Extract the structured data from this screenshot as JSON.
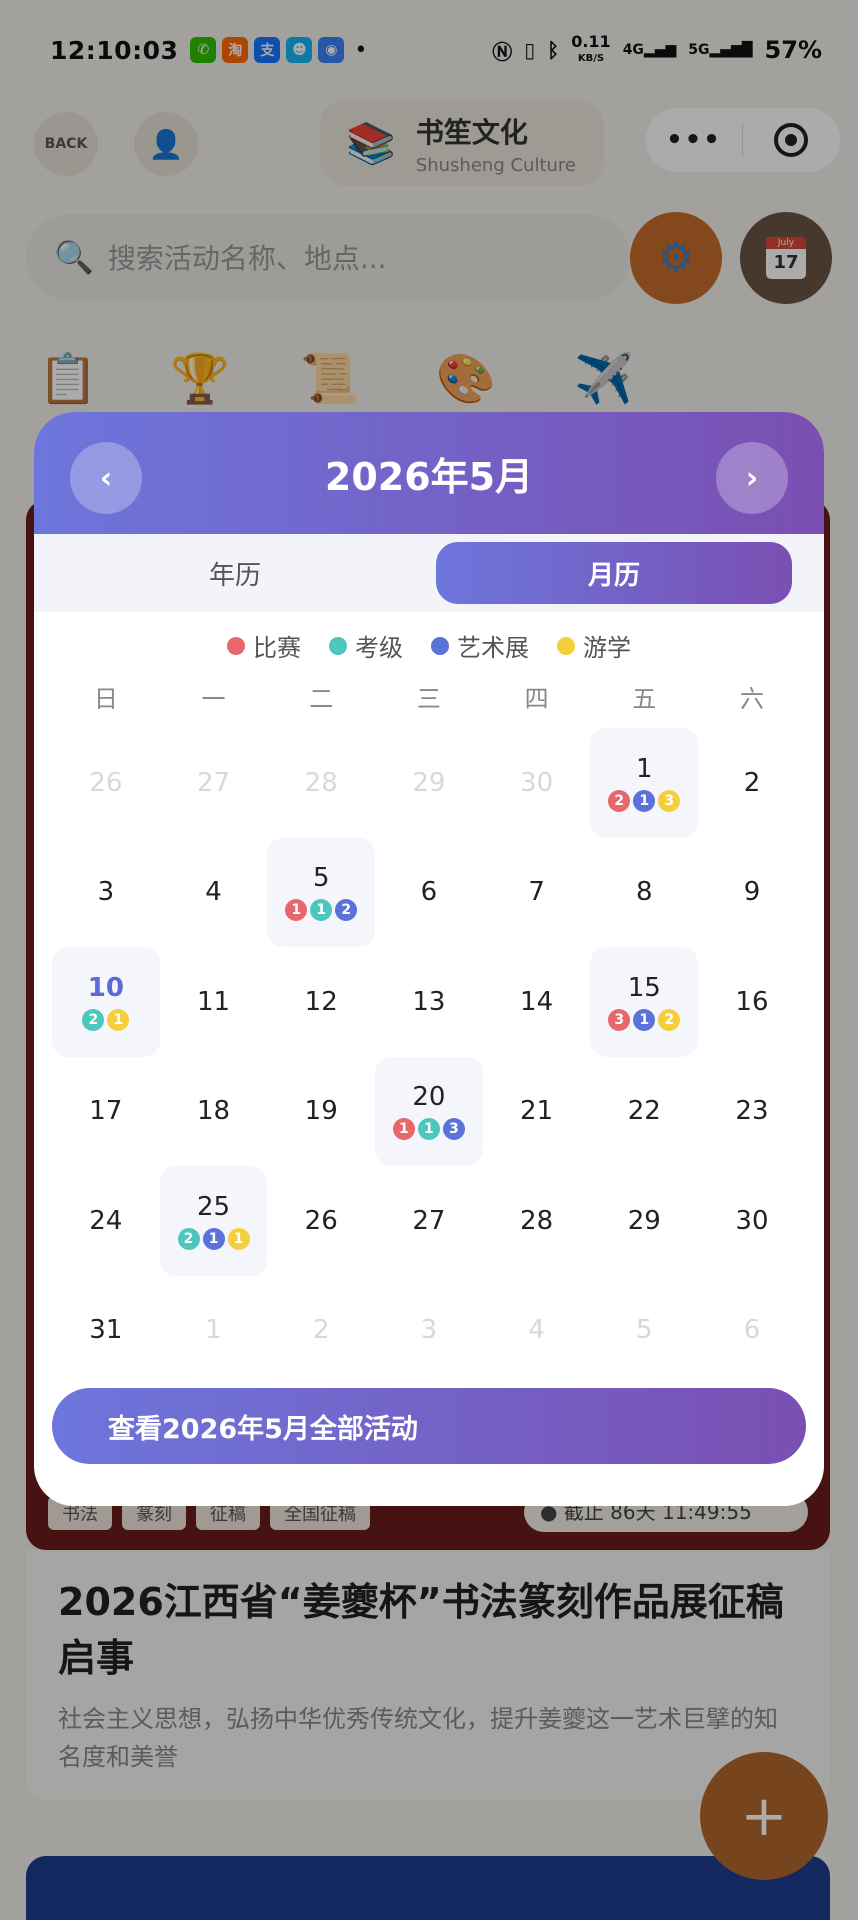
{
  "status_bar": {
    "time": "12:10:03",
    "apps": [
      {
        "name": "wechat-icon",
        "glyph": "✆",
        "color": "#2dc100"
      },
      {
        "name": "taobao-icon",
        "glyph": "淘",
        "color": "#ff6a00"
      },
      {
        "name": "alipay-icon",
        "glyph": "支",
        "color": "#1677ff"
      },
      {
        "name": "qq-icon",
        "glyph": "☻",
        "color": "#12b7f5"
      },
      {
        "name": "contact-icon",
        "glyph": "◉",
        "color": "#3b82f6"
      }
    ],
    "more": "•",
    "network_speed": "0.11",
    "network_unit": "KB/S",
    "signal_4g": "4G",
    "signal_5g": "5G",
    "battery": "57%"
  },
  "header": {
    "back_label": "BACK",
    "brand_cn": "书笙文化",
    "brand_en": "Shusheng Culture",
    "capsule_more": "•••"
  },
  "search": {
    "placeholder": "搜索活动名称、地点..."
  },
  "calendar_button": {
    "month": "July",
    "day": "17"
  },
  "categories": [
    {
      "name": "clipboard-icon",
      "glyph": "📋"
    },
    {
      "name": "trophy-icon",
      "glyph": "🏆"
    },
    {
      "name": "scroll-icon",
      "glyph": "📜"
    },
    {
      "name": "palette-icon",
      "glyph": "🎨"
    },
    {
      "name": "airplane-icon",
      "glyph": "✈️"
    }
  ],
  "background_card": {
    "tags": [
      "书法",
      "篆刻",
      "征稿",
      "全国征稿"
    ],
    "deadline": "● 截止 86天 11:49:55",
    "title": "2026江西省“姜夔杯”书法篆刻作品展征稿启事",
    "description": "社会主义思想，弘扬中华优秀传统文化，提升姜夔这一艺术巨擘的知名度和美誉"
  },
  "fab_label": "+",
  "calendar": {
    "title": "2026年5月",
    "prev_label": "‹",
    "next_label": "›",
    "tabs": [
      {
        "label": "年历",
        "active": false
      },
      {
        "label": "月历",
        "active": true
      }
    ],
    "legend": [
      {
        "label": "比赛",
        "color": "#e8676b"
      },
      {
        "label": "考级",
        "color": "#4cc7bd"
      },
      {
        "label": "艺术展",
        "color": "#5b73d9"
      },
      {
        "label": "游学",
        "color": "#f5cf3b"
      }
    ],
    "weekdays": [
      "日",
      "一",
      "二",
      "三",
      "四",
      "五",
      "六"
    ],
    "days": [
      {
        "label": "26",
        "other": true
      },
      {
        "label": "27",
        "other": true
      },
      {
        "label": "28",
        "other": true
      },
      {
        "label": "29",
        "other": true
      },
      {
        "label": "30",
        "other": true
      },
      {
        "label": "1",
        "events": [
          {
            "type": 0,
            "count": "2"
          },
          {
            "type": 2,
            "count": "1"
          },
          {
            "type": 3,
            "count": "3"
          }
        ]
      },
      {
        "label": "2"
      },
      {
        "label": "3"
      },
      {
        "label": "4"
      },
      {
        "label": "5",
        "events": [
          {
            "type": 0,
            "count": "1"
          },
          {
            "type": 1,
            "count": "1"
          },
          {
            "type": 2,
            "count": "2"
          }
        ]
      },
      {
        "label": "6"
      },
      {
        "label": "7"
      },
      {
        "label": "8"
      },
      {
        "label": "9"
      },
      {
        "label": "10",
        "sunday": true,
        "events": [
          {
            "type": 1,
            "count": "2"
          },
          {
            "type": 3,
            "count": "1"
          }
        ]
      },
      {
        "label": "11"
      },
      {
        "label": "12"
      },
      {
        "label": "13"
      },
      {
        "label": "14"
      },
      {
        "label": "15",
        "events": [
          {
            "type": 0,
            "count": "3"
          },
          {
            "type": 2,
            "count": "1"
          },
          {
            "type": 3,
            "count": "2"
          }
        ]
      },
      {
        "label": "16"
      },
      {
        "label": "17"
      },
      {
        "label": "18"
      },
      {
        "label": "19"
      },
      {
        "label": "20",
        "events": [
          {
            "type": 0,
            "count": "1"
          },
          {
            "type": 1,
            "count": "1"
          },
          {
            "type": 2,
            "count": "3"
          }
        ]
      },
      {
        "label": "21"
      },
      {
        "label": "22"
      },
      {
        "label": "23"
      },
      {
        "label": "24"
      },
      {
        "label": "25",
        "events": [
          {
            "type": 1,
            "count": "2"
          },
          {
            "type": 2,
            "count": "1"
          },
          {
            "type": 3,
            "count": "1"
          }
        ]
      },
      {
        "label": "26"
      },
      {
        "label": "27"
      },
      {
        "label": "28"
      },
      {
        "label": "29"
      },
      {
        "label": "30"
      },
      {
        "label": "31"
      },
      {
        "label": "1",
        "other": true
      },
      {
        "label": "2",
        "other": true
      },
      {
        "label": "3",
        "other": true
      },
      {
        "label": "4",
        "other": true
      },
      {
        "label": "5",
        "other": true
      },
      {
        "label": "6",
        "other": true
      }
    ],
    "view_all_label": "查看2026年5月全部活动"
  }
}
